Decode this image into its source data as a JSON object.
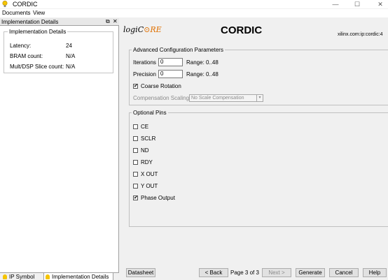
{
  "window": {
    "title": "CORDIC",
    "minimize": "—",
    "maximize": "☐",
    "close": "✕"
  },
  "menu": {
    "documents": "Documents",
    "view": "View"
  },
  "left_pane": {
    "header": "Implementation Details",
    "restore_icon": "⧉",
    "close_icon": "✕",
    "group_title": "Implementation Details",
    "rows": [
      {
        "label": "Latency:",
        "value": "24"
      },
      {
        "label": "BRAM count:",
        "value": "N/A"
      },
      {
        "label": "Mult/DSP Slice count:",
        "value": "N/A"
      }
    ],
    "tabs": {
      "ip_symbol": "IP Symbol",
      "implementation_details": "Implementation Details"
    }
  },
  "header": {
    "logo_prefix": "logiC",
    "logo_accent": "⊙RE",
    "core_name": "CORDIC",
    "vendor_id": "xilinx.com:ip:cordic:4"
  },
  "advanced": {
    "title": "Advanced Configuration Parameters",
    "iterations": {
      "label": "Iterations",
      "value": "0",
      "range": "Range: 0..48"
    },
    "precision": {
      "label": "Precision",
      "value": "0",
      "range": "Range: 0..48"
    },
    "coarse_rotation": {
      "label": "Coarse Rotation",
      "checked": "✔"
    },
    "compensation": {
      "label": "Compensation Scaling",
      "value": "No Scale Compensation",
      "arrow": "▾"
    }
  },
  "optional_pins": {
    "title": "Optional Pins",
    "pins": [
      {
        "label": "CE",
        "checked": ""
      },
      {
        "label": "SCLR",
        "checked": ""
      },
      {
        "label": "ND",
        "checked": ""
      },
      {
        "label": "RDY",
        "checked": ""
      },
      {
        "label": "X OUT",
        "checked": ""
      },
      {
        "label": "Y OUT",
        "checked": ""
      },
      {
        "label": "Phase Output",
        "checked": "✔"
      }
    ]
  },
  "footer": {
    "datasheet": "Datasheet",
    "back": "< Back",
    "page": "Page 3 of 3",
    "next": "Next >",
    "generate": "Generate",
    "cancel": "Cancel",
    "help": "Help"
  },
  "colors": {
    "logo_accent": "#e07000",
    "icon_yellow": "#f5c400"
  }
}
